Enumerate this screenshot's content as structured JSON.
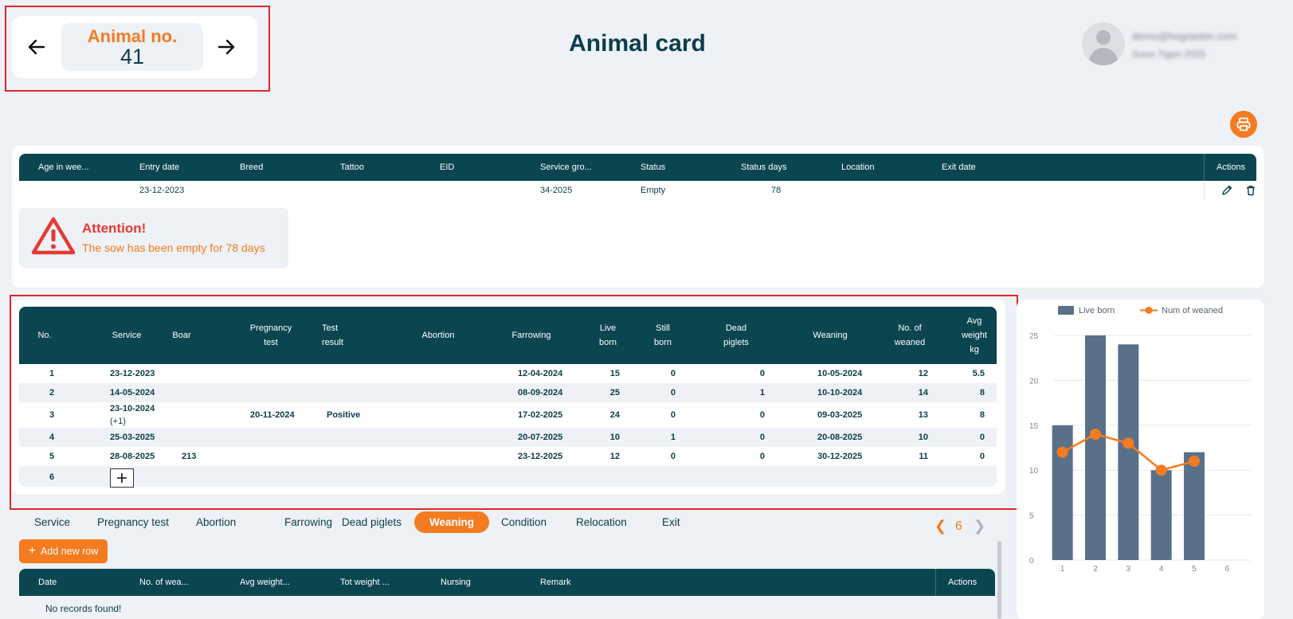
{
  "header": {
    "animal_label": "Animal no.",
    "animal_number": "41",
    "title": "Animal card",
    "user_email": "demo@hogrankin.com",
    "user_subtitle": "Sows Tigen 2025"
  },
  "info_table": {
    "columns": [
      "Age in wee...",
      "Entry date",
      "Breed",
      "Tattoo",
      "EID",
      "Service gro...",
      "Status",
      "Status days",
      "Location",
      "Exit date",
      "Actions"
    ],
    "row": {
      "age": "",
      "entry_date": "23-12-2023",
      "breed": "",
      "tattoo": "",
      "eid": "",
      "service_group": "34-2025",
      "status": "Empty",
      "status_days": "78",
      "location": "",
      "exit_date": ""
    }
  },
  "alert": {
    "title": "Attention!",
    "text": "The sow has been empty for 78 days"
  },
  "litter_table": {
    "columns": [
      "No.",
      "Service",
      "Boar",
      "Pregnancy test",
      "Test result",
      "Abortion",
      "Farrowing",
      "Live born",
      "Still born",
      "Dead piglets",
      "Weaning",
      "No. of weaned",
      "Avg weight kg"
    ],
    "rows": [
      {
        "no": "1",
        "service": "23-12-2023",
        "service_extra": "",
        "boar": "",
        "preg_test": "",
        "test_result": "",
        "abortion": "",
        "farrowing": "12-04-2024",
        "live": "15",
        "still": "0",
        "dead": "0",
        "weaning": "10-05-2024",
        "weaned": "12",
        "avg": "5.5"
      },
      {
        "no": "2",
        "service": "14-05-2024",
        "service_extra": "",
        "boar": "",
        "preg_test": "",
        "test_result": "",
        "abortion": "",
        "farrowing": "08-09-2024",
        "live": "25",
        "still": "0",
        "dead": "1",
        "weaning": "10-10-2024",
        "weaned": "14",
        "avg": "8"
      },
      {
        "no": "3",
        "service": "23-10-2024",
        "service_extra": "(+1)",
        "boar": "",
        "preg_test": "20-11-2024",
        "test_result": "Positive",
        "abortion": "",
        "farrowing": "17-02-2025",
        "live": "24",
        "still": "0",
        "dead": "0",
        "weaning": "09-03-2025",
        "weaned": "13",
        "avg": "8"
      },
      {
        "no": "4",
        "service": "25-03-2025",
        "service_extra": "",
        "boar": "",
        "preg_test": "",
        "test_result": "",
        "abortion": "",
        "farrowing": "20-07-2025",
        "live": "10",
        "still": "1",
        "dead": "0",
        "weaning": "20-08-2025",
        "weaned": "10",
        "avg": "0"
      },
      {
        "no": "5",
        "service": "28-08-2025",
        "service_extra": "",
        "boar": "213",
        "preg_test": "",
        "test_result": "",
        "abortion": "",
        "farrowing": "23-12-2025",
        "live": "12",
        "still": "0",
        "dead": "0",
        "weaning": "30-12-2025",
        "weaned": "11",
        "avg": "0"
      }
    ],
    "new_row_no": "6"
  },
  "tabs": [
    "Service",
    "Pregnancy test",
    "Abortion",
    "Farrowing",
    "Dead piglets",
    "Weaning",
    "Condition",
    "Relocation",
    "Exit"
  ],
  "active_tab": "Weaning",
  "pager": {
    "current": "6",
    "prev_icon": "chevron-left-icon",
    "next_icon": "chevron-right-icon"
  },
  "weaning_table": {
    "add_label": "Add new row",
    "columns": [
      "Date",
      "No. of wea...",
      "Avg weight...",
      "Tot weight ...",
      "Nursing",
      "Remark",
      "Actions"
    ],
    "empty_text": "No records found!"
  },
  "colors": {
    "accent": "#f47b20",
    "header_dark": "#0b4550",
    "bar": "#5a7089",
    "alert_red": "#e53935",
    "highlight": "#e0262d"
  },
  "chart_data": {
    "type": "bar",
    "categories": [
      "1",
      "2",
      "3",
      "4",
      "5",
      "6"
    ],
    "series": [
      {
        "name": "Live born",
        "type": "bar",
        "values": [
          15,
          25,
          24,
          10,
          12,
          null
        ]
      },
      {
        "name": "Num of weaned",
        "type": "line",
        "values": [
          12,
          14,
          13,
          10,
          11,
          null
        ]
      }
    ],
    "yticks": [
      "0",
      "5",
      "10",
      "15",
      "20",
      "25"
    ],
    "ylim": [
      0,
      25
    ],
    "legend_position": "top",
    "grid": true
  }
}
